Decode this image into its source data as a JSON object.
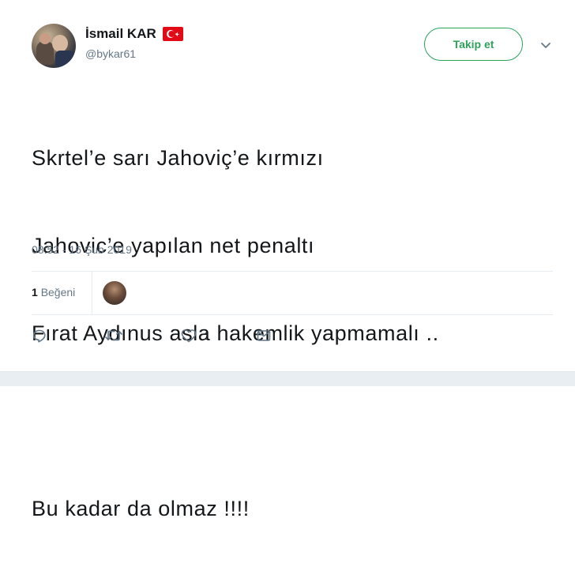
{
  "user": {
    "display_name": "İsmail KAR",
    "handle": "@bykar61",
    "flag_icon": "turkey-flag-icon"
  },
  "header": {
    "follow_label": "Takip et",
    "menu_icon": "chevron-down-icon"
  },
  "tweet": {
    "lines": [
      "Skrtel’e sarı Jahoviç’e kırmızı",
      "Jahovic’e yapılan net penaltı",
      "Fırat Aydınus asla hakemlik yapmamalı ..",
      "Bu kadar da olmaz !!!!"
    ],
    "timestamp": "08:52 - 16 Şub 2019"
  },
  "stats": {
    "likes_count": "1",
    "likes_label": "Beğeni"
  },
  "actions": {
    "reply_icon": "reply-icon",
    "retweet_icon": "retweet-icon",
    "like_icon": "heart-icon",
    "like_count": "1",
    "dm_icon": "envelope-icon"
  },
  "colors": {
    "accent": "#2ea15a",
    "muted": "#657786",
    "text": "#14171a",
    "flag_red": "#e30a17"
  }
}
